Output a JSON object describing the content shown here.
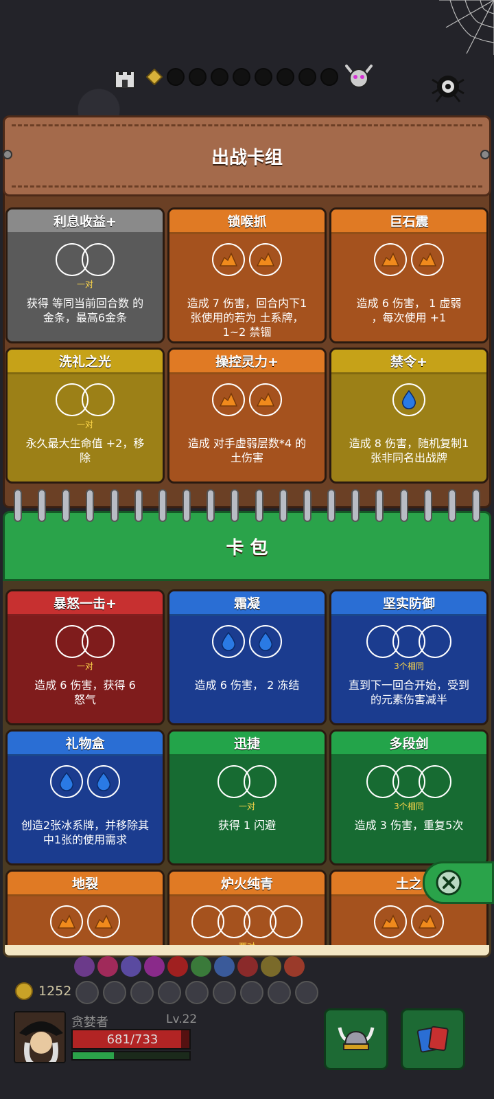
{
  "deck": {
    "title": "出战卡组",
    "cards": [
      {
        "name": "利息收益+",
        "color": "gray",
        "slots": [
          "empty",
          "empty"
        ],
        "slot_label": "一对",
        "desc": [
          "获得 等同当前回合数 的",
          "金条，最高6金条"
        ]
      },
      {
        "name": "锁喉抓",
        "color": "orange",
        "slots": [
          "earth",
          "earth"
        ],
        "slot_label": "",
        "desc": [
          "造成 7 伤害，回合内下1",
          "张使用的若为 土系牌，",
          "1~2 禁锢"
        ]
      },
      {
        "name": "巨石震",
        "color": "orange",
        "slots": [
          "earth",
          "earth"
        ],
        "slot_label": "",
        "desc": [
          "造成 6 伤害， 1 虚弱",
          "，每次使用 +1"
        ]
      },
      {
        "name": "洗礼之光",
        "color": "yellow",
        "slots": [
          "empty",
          "empty"
        ],
        "slot_label": "一对",
        "desc": [
          "永久最大生命值 +2，移",
          "除"
        ]
      },
      {
        "name": "操控灵力+",
        "color": "orange",
        "slots": [
          "earth",
          "earth"
        ],
        "slot_label": "",
        "desc": [
          "造成 对手虚弱层数*4 的",
          "土伤害"
        ]
      },
      {
        "name": "禁令+",
        "color": "yellow",
        "slots": [
          "water"
        ],
        "slot_label": "",
        "desc": [
          "造成 8 伤害，随机复制1",
          "张非同名出战牌"
        ]
      }
    ]
  },
  "pack": {
    "title": "卡 包",
    "cards": [
      {
        "name": "暴怒一击+",
        "color": "red",
        "slots": [
          "empty",
          "empty"
        ],
        "slot_label": "一对",
        "desc": [
          "造成 6 伤害，获得 6",
          "怒气"
        ]
      },
      {
        "name": "霜凝",
        "color": "blue",
        "slots": [
          "water",
          "water"
        ],
        "slot_label": "",
        "desc": [
          "造成 6 伤害， 2 冻结"
        ]
      },
      {
        "name": "坚实防御",
        "color": "blue",
        "slots": [
          "empty",
          "empty",
          "empty"
        ],
        "slot_label": "3个相同",
        "desc": [
          "直到下一回合开始，受到",
          "的元素伤害减半"
        ]
      },
      {
        "name": "礼物盒",
        "color": "blue",
        "slots": [
          "water",
          "water"
        ],
        "slot_label": "",
        "desc": [
          "创造2张冰系牌，并移除其",
          "中1张的使用需求"
        ]
      },
      {
        "name": "迅捷",
        "color": "green",
        "slots": [
          "empty",
          "empty"
        ],
        "slot_label": "一对",
        "desc": [
          "获得 1 闪避"
        ]
      },
      {
        "name": "多段剑",
        "color": "green",
        "slots": [
          "empty",
          "empty",
          "empty"
        ],
        "slot_label": "3个相同",
        "desc": [
          "造成 3 伤害，重复5次"
        ]
      },
      {
        "name": "地裂",
        "color": "orange",
        "slots": [
          "earth",
          "earth"
        ],
        "slot_label": "",
        "desc": []
      },
      {
        "name": "炉火纯青",
        "color": "orange",
        "slots": [
          "empty",
          "empty",
          "empty",
          "empty"
        ],
        "slot_label": "两对",
        "desc": []
      },
      {
        "name": "土之",
        "color": "orange",
        "slots": [
          "earth",
          "earth"
        ],
        "slot_label": "",
        "desc": []
      }
    ]
  },
  "player": {
    "gold": "1252",
    "name": "贪婪者",
    "level": "Lv.22",
    "hp": "681/733",
    "hp_fraction": 0.93,
    "xp_fraction": 0.35
  },
  "icons": {
    "settings": "settings-gear-icon",
    "close": "close-icon",
    "castle": "castle-icon",
    "boss": "boss-skull-icon"
  },
  "colors": {
    "deck_bg": "#6b4025",
    "pack_header": "#2aa34a"
  }
}
